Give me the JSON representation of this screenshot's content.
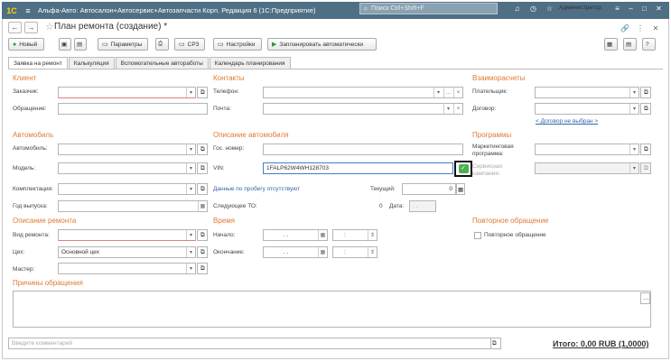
{
  "app": {
    "logo": "1С",
    "title": "Альфа-Авто: Автосалон+Автосервис+Автозапчасти Корп. Редакция 6  (1С:Предприятие)",
    "search_placeholder": "Поиск Ctrl+Shift+F",
    "user": "Администратор"
  },
  "form": {
    "title": "План ремонта (создание) *"
  },
  "toolbar": {
    "new": "Новый",
    "params": "Параметры",
    "srz": "СРЗ",
    "settings": "Настройки",
    "schedule": "Запланировать автоматически"
  },
  "tabs": [
    "Заявка на ремонт",
    "Калькуляция",
    "Вспомогательные автоработы",
    "Календарь планирования"
  ],
  "client": {
    "heading": "Клиент",
    "customer": "Заказчик:",
    "address": "Обращение:"
  },
  "contacts": {
    "heading": "Контакты",
    "phone": "Телефон:",
    "mail": "Почта:"
  },
  "settlements": {
    "heading": "Взаиморасчеты",
    "payer": "Плательщик:",
    "contract": "Договор:",
    "contract_link": "< Договор не выбран >"
  },
  "car": {
    "heading": "Автомобиль",
    "car": "Автомобиль:",
    "model": "Модель:",
    "config": "Комплектация:",
    "year": "Год выпуска:"
  },
  "car_desc": {
    "heading": "Описание автомобиля",
    "plate": "Гос. номер:",
    "vin": "VIN:",
    "vin_value": "1FALP62W4WH128703",
    "mileage_link": "Данные по пробегу отсутствуют",
    "current": "Текущий:",
    "current_value": "0",
    "next_to": "Следующее ТО:",
    "next_to_value": "0",
    "date": "Дата:",
    "date_value": ". ."
  },
  "programs": {
    "heading": "Программы",
    "marketing": "Маркетинговая программа:",
    "service": "Сервисная кампания:"
  },
  "repair": {
    "heading": "Описание ремонта",
    "type": "Вид ремонта:",
    "shop": "Цех:",
    "shop_value": "Основной цех",
    "master": "Мастер:"
  },
  "time": {
    "heading": "Время",
    "start": "Начало:",
    "end": "Окончание:",
    "date_mask": ". .",
    "time_mask": ":"
  },
  "repeat": {
    "heading": "Повторное обращение",
    "checkbox": "Повторное обращение"
  },
  "reasons": {
    "heading": "Причины обращения"
  },
  "footer": {
    "comment_placeholder": "Введите комментарий",
    "total": "Итого: 0,00 RUB (1,0000)"
  }
}
